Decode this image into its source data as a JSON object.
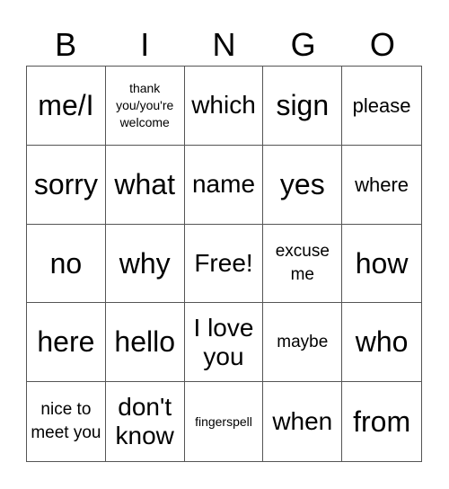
{
  "header": [
    "B",
    "I",
    "N",
    "G",
    "O"
  ],
  "cells": [
    {
      "text": "me/I",
      "size": "xl"
    },
    {
      "text": "thank you/you're welcome",
      "size": "xs"
    },
    {
      "text": "which",
      "size": "lg"
    },
    {
      "text": "sign",
      "size": "xl"
    },
    {
      "text": "please",
      "size": "md"
    },
    {
      "text": "sorry",
      "size": "xl"
    },
    {
      "text": "what",
      "size": "xl"
    },
    {
      "text": "name",
      "size": "lg"
    },
    {
      "text": "yes",
      "size": "xl"
    },
    {
      "text": "where",
      "size": "md"
    },
    {
      "text": "no",
      "size": "xl"
    },
    {
      "text": "why",
      "size": "xl"
    },
    {
      "text": "Free!",
      "size": "lg"
    },
    {
      "text": "excuse me",
      "size": "sm"
    },
    {
      "text": "how",
      "size": "xl"
    },
    {
      "text": "here",
      "size": "xl"
    },
    {
      "text": "hello",
      "size": "xl"
    },
    {
      "text": "I love you",
      "size": "lg"
    },
    {
      "text": "maybe",
      "size": "sm"
    },
    {
      "text": "who",
      "size": "xl"
    },
    {
      "text": "nice to meet you",
      "size": "sm"
    },
    {
      "text": "don't know",
      "size": "lg"
    },
    {
      "text": "fingerspell",
      "size": "xs"
    },
    {
      "text": "when",
      "size": "lg"
    },
    {
      "text": "from",
      "size": "xl"
    }
  ]
}
